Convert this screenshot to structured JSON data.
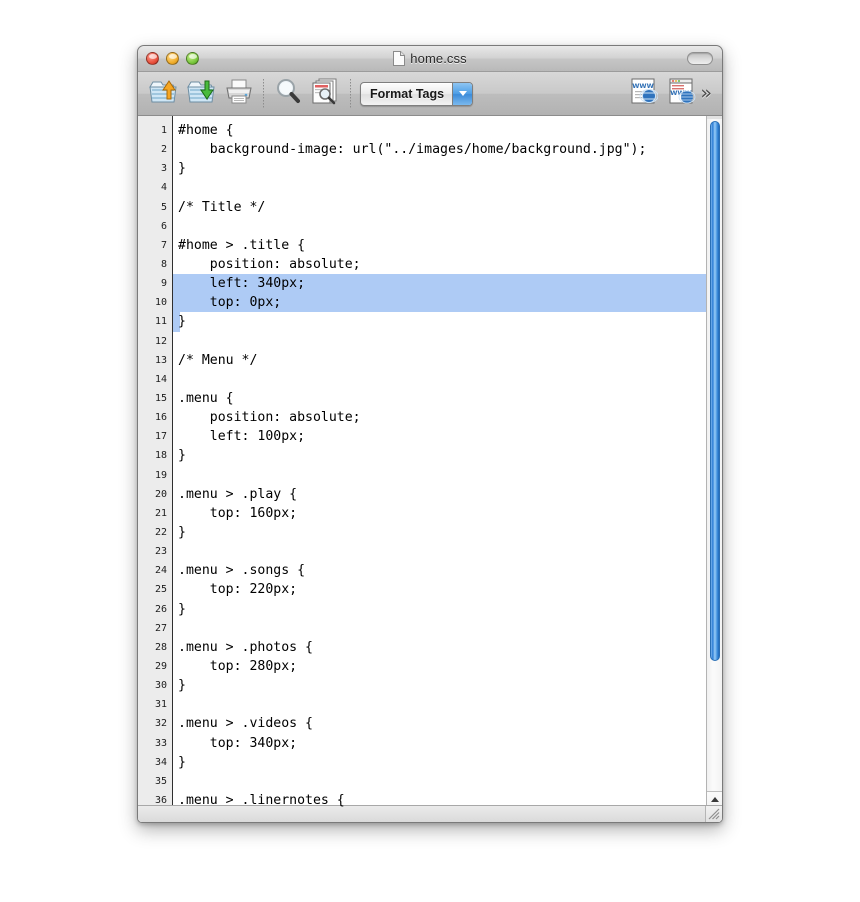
{
  "window": {
    "title": "home.css",
    "title_icon": "document-icon",
    "traffic_lights": [
      {
        "name": "close-button",
        "label": "Close",
        "color": "#e8503c"
      },
      {
        "name": "minimize-button",
        "label": "Minimize",
        "color": "#f0ad2a"
      },
      {
        "name": "zoom-button",
        "label": "Zoom",
        "color": "#79c73c"
      }
    ],
    "toolbar_toggle_label": ""
  },
  "toolbar": {
    "items": [
      {
        "name": "upload-button",
        "icon": "folder-upload-icon",
        "label": "Put"
      },
      {
        "name": "download-button",
        "icon": "folder-download-icon",
        "label": "Get"
      },
      {
        "name": "print-button",
        "icon": "printer-icon",
        "label": "Print"
      },
      {
        "name": "find-button",
        "icon": "magnifier-icon",
        "label": "Find"
      },
      {
        "name": "find-in-files-button",
        "icon": "document-search-icon",
        "label": "Find in Files"
      }
    ],
    "format_tags": {
      "label": "Format Tags",
      "arrow_icon": "chevron-down-icon"
    },
    "right_items": [
      {
        "name": "preview-button",
        "icon": "web-preview-icon",
        "label": "Preview"
      },
      {
        "name": "preview-in-browser-button",
        "icon": "web-browser-preview-icon",
        "label": "Preview in Browser"
      }
    ],
    "overflow_label": "»",
    "accent_color": "#3c8bd9"
  },
  "editor": {
    "selection_color": "#aecbf5",
    "selected_lines": [
      9,
      10
    ],
    "partial_selected_line": 11,
    "lines": [
      {
        "n": 1,
        "text": "#home {"
      },
      {
        "n": 2,
        "text": "    background-image: url(\"../images/home/background.jpg\");"
      },
      {
        "n": 3,
        "text": "}"
      },
      {
        "n": 4,
        "text": ""
      },
      {
        "n": 5,
        "text": "/* Title */"
      },
      {
        "n": 6,
        "text": ""
      },
      {
        "n": 7,
        "text": "#home > .title {"
      },
      {
        "n": 8,
        "text": "    position: absolute;"
      },
      {
        "n": 9,
        "text": "    left: 340px;"
      },
      {
        "n": 10,
        "text": "    top: 0px;"
      },
      {
        "n": 11,
        "text": "}"
      },
      {
        "n": 12,
        "text": ""
      },
      {
        "n": 13,
        "text": "/* Menu */"
      },
      {
        "n": 14,
        "text": ""
      },
      {
        "n": 15,
        "text": ".menu {"
      },
      {
        "n": 16,
        "text": "    position: absolute;"
      },
      {
        "n": 17,
        "text": "    left: 100px;"
      },
      {
        "n": 18,
        "text": "}"
      },
      {
        "n": 19,
        "text": ""
      },
      {
        "n": 20,
        "text": ".menu > .play {"
      },
      {
        "n": 21,
        "text": "    top: 160px;"
      },
      {
        "n": 22,
        "text": "}"
      },
      {
        "n": 23,
        "text": ""
      },
      {
        "n": 24,
        "text": ".menu > .songs {"
      },
      {
        "n": 25,
        "text": "    top: 220px;"
      },
      {
        "n": 26,
        "text": "}"
      },
      {
        "n": 27,
        "text": ""
      },
      {
        "n": 28,
        "text": ".menu > .photos {"
      },
      {
        "n": 29,
        "text": "    top: 280px;"
      },
      {
        "n": 30,
        "text": "}"
      },
      {
        "n": 31,
        "text": ""
      },
      {
        "n": 32,
        "text": ".menu > .videos {"
      },
      {
        "n": 33,
        "text": "    top: 340px;"
      },
      {
        "n": 34,
        "text": "}"
      },
      {
        "n": 35,
        "text": ""
      },
      {
        "n": 36,
        "text": ".menu > .linernotes {"
      }
    ]
  },
  "scrollbar": {
    "up_arrow_icon": "triangle-up-icon",
    "down_arrow_icon": "triangle-down-icon",
    "thumb_color": "#3d8ddc"
  },
  "resize_grip_icon": "resize-grip-icon"
}
